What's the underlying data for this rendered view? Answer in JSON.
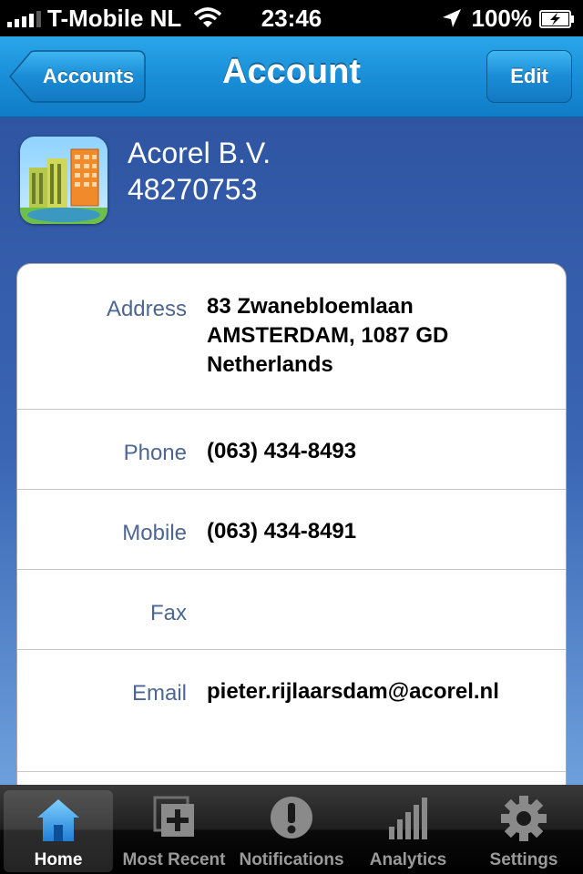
{
  "status_bar": {
    "carrier": "T-Mobile NL",
    "time": "23:46",
    "battery": "100%"
  },
  "nav": {
    "back_label": "Accounts",
    "title": "Account",
    "edit_label": "Edit"
  },
  "account": {
    "name": "Acorel B.V.",
    "number": "48270753"
  },
  "details": {
    "address_label": "Address",
    "address_lines": [
      "83 Zwanebloemlaan",
      "AMSTERDAM, 1087 GD",
      "Netherlands"
    ],
    "phone_label": "Phone",
    "phone": "(063) 434-8493",
    "mobile_label": "Mobile",
    "mobile": "(063) 434-8491",
    "fax_label": "Fax",
    "fax": "",
    "email_label": "Email",
    "email": "pieter.rijlaarsdam@acorel.nl"
  },
  "tabs": [
    {
      "label": "Home",
      "icon": "home-icon",
      "active": true
    },
    {
      "label": "Most Recent",
      "icon": "most-recent-icon",
      "active": false
    },
    {
      "label": "Notifications",
      "icon": "exclamation-icon",
      "active": false
    },
    {
      "label": "Analytics",
      "icon": "bar-chart-icon",
      "active": false
    },
    {
      "label": "Settings",
      "icon": "gear-icon",
      "active": false
    }
  ],
  "colors": {
    "nav_blue": "#1a8fd8",
    "background_top": "#2b4f9c",
    "background_bottom": "#8fbdf0",
    "label_blue": "#4d6693"
  }
}
